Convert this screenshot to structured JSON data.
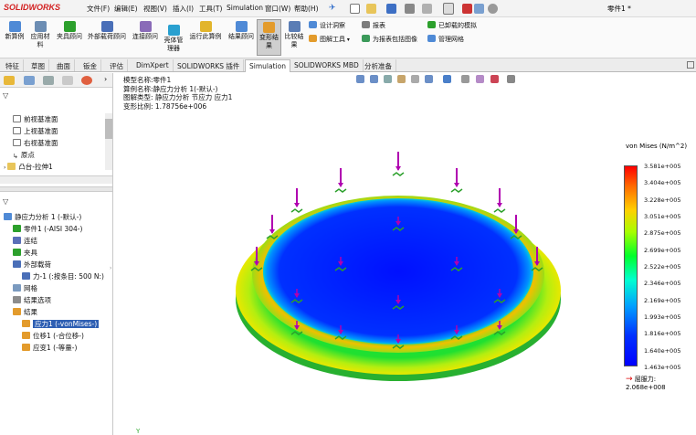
{
  "app": {
    "logo": "SOLIDWORKS",
    "document_title": "零件1 *"
  },
  "menu": [
    "文件(F)",
    "编辑(E)",
    "视图(V)",
    "插入(I)",
    "工具(T)",
    "Simulation",
    "窗口(W)",
    "帮助(H)"
  ],
  "ribbon": {
    "buttons": [
      "新算例",
      "应用材料",
      "夹具顾问",
      "外部载荷顾问",
      "连接顾问",
      "壳体管理器",
      "运行此算例",
      "结果顾问",
      "变形结果",
      "比较结果"
    ],
    "small": [
      "设计洞察",
      "图解工具",
      "报表",
      "为报表包括图像",
      "已卸载的模拟",
      "管理网格"
    ]
  },
  "tabs": [
    "特征",
    "草图",
    "曲面",
    "钣金",
    "评估",
    "DimXpert",
    "SOLIDWORKS 插件",
    "Simulation",
    "SOLIDWORKS MBD",
    "分析准备"
  ],
  "active_tab": "Simulation",
  "tree_top": [
    "前视基准面",
    "上视基准面",
    "右视基准面",
    "原点",
    "凸台-拉伸1"
  ],
  "tree": [
    {
      "label": "静应力分析 1 (-默认-)",
      "indent": 0
    },
    {
      "label": "零件1 (-AISI 304-)",
      "indent": 1
    },
    {
      "label": "连结",
      "indent": 1
    },
    {
      "label": "夹具",
      "indent": 1
    },
    {
      "label": "外部载荷",
      "indent": 1
    },
    {
      "label": "力-1 (:按条目: 500 N:)",
      "indent": 2
    },
    {
      "label": "网格",
      "indent": 1
    },
    {
      "label": "结果选项",
      "indent": 1
    },
    {
      "label": "结果",
      "indent": 1
    },
    {
      "label": "应力1 (-vonMises-)",
      "indent": 2,
      "selected": true
    },
    {
      "label": "位移1 (-合位移-)",
      "indent": 2
    },
    {
      "label": "应变1 (-等量-)",
      "indent": 2
    }
  ],
  "info": {
    "line1": "模型名称:零件1",
    "line2": "算例名称:静应力分析 1(-默认-)",
    "line3": "图解类型: 静应力分析 节应力 应力1",
    "line4": "变形比例: 1.78756e+006"
  },
  "legend": {
    "title": "von Mises (N/m^2)",
    "ticks": [
      "3.581e+005",
      "3.404e+005",
      "3.228e+005",
      "3.051e+005",
      "2.875e+005",
      "2.699e+005",
      "2.522e+005",
      "2.346e+005",
      "2.169e+005",
      "1.993e+005",
      "1.816e+005",
      "1.640e+005",
      "1.463e+005"
    ],
    "yield_label": "屈服力:",
    "yield_value": "2.068e+008"
  },
  "colors": {
    "red": "#ff0000",
    "blue": "#0000ff",
    "load_arrow": "#b000b0",
    "fixture": "#2ca02c"
  }
}
